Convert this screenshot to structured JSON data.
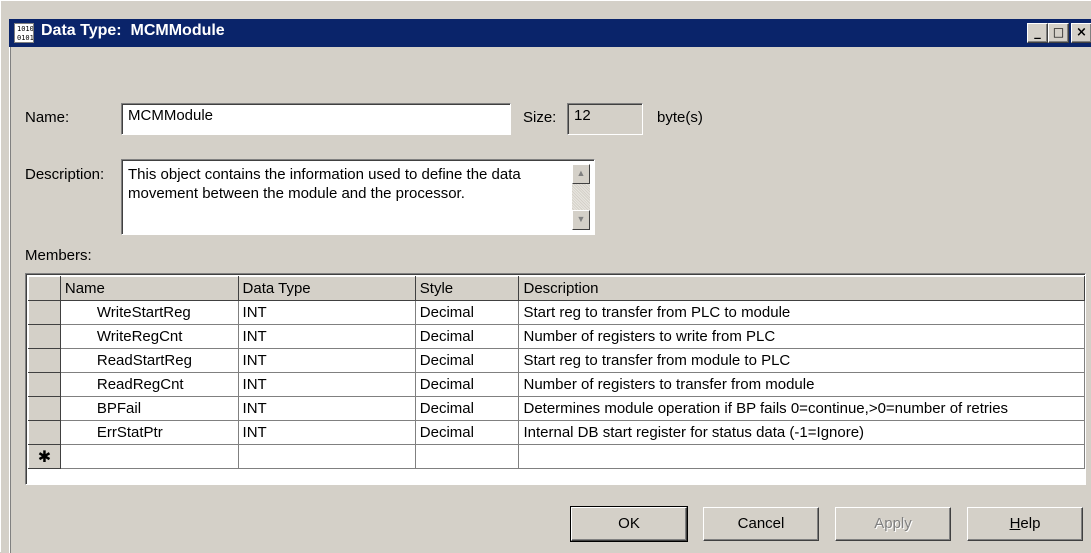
{
  "window": {
    "title": "Data Type:  MCMModule",
    "icon_text": "1010\n0101",
    "minimize_symbol": "_",
    "restore_symbol": "□",
    "close_symbol": "×"
  },
  "form": {
    "name_label": "Name:",
    "name_value": "MCMModule",
    "size_label": "Size:",
    "size_value": "12",
    "size_unit": "byte(s)",
    "description_label": "Description:",
    "description_value": "This object contains the information used to define the data movement between the module and the processor.",
    "members_label": "Members:"
  },
  "members_table": {
    "columns": [
      "Name",
      "Data Type",
      "Style",
      "Description"
    ],
    "rows": [
      {
        "name": "WriteStartReg",
        "data_type": "INT",
        "style": "Decimal",
        "description": "Start reg to transfer from PLC to module"
      },
      {
        "name": "WriteRegCnt",
        "data_type": "INT",
        "style": "Decimal",
        "description": "Number of registers to write from PLC"
      },
      {
        "name": "ReadStartReg",
        "data_type": "INT",
        "style": "Decimal",
        "description": "Start reg to transfer from module to PLC"
      },
      {
        "name": "ReadRegCnt",
        "data_type": "INT",
        "style": "Decimal",
        "description": "Number of registers to transfer from module"
      },
      {
        "name": "BPFail",
        "data_type": "INT",
        "style": "Decimal",
        "description": "Determines module operation if BP fails 0=continue,>0=number of retries"
      },
      {
        "name": "ErrStatPtr",
        "data_type": "INT",
        "style": "Decimal",
        "description": "Internal DB start register for status data (-1=Ignore)"
      }
    ],
    "new_row_marker": "✱"
  },
  "buttons": {
    "ok": "OK",
    "cancel": "Cancel",
    "apply": "Apply",
    "help_first": "H",
    "help_rest": "elp"
  },
  "colors": {
    "titlebar": "#0a246a",
    "face": "#d4d0c8"
  }
}
